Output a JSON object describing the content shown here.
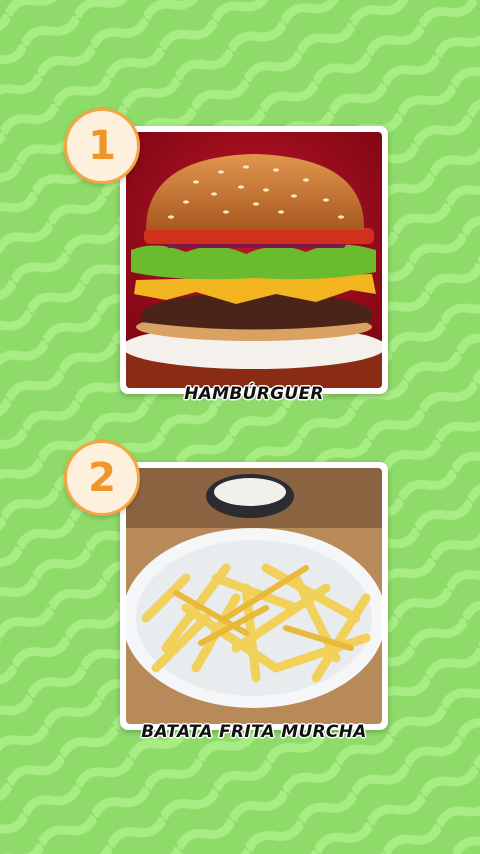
{
  "colors": {
    "background": "#8fdb6a",
    "wave": "#a6ea82",
    "badge_fill": "#fdf0dc",
    "badge_ring": "#f5a542",
    "badge_text": "#f0952a"
  },
  "items": [
    {
      "number": "1",
      "caption": "HAMBÚRGUER",
      "image": "hamburger-photo"
    },
    {
      "number": "2",
      "caption": "BATATA FRITA MURCHA",
      "image": "french-fries-photo"
    }
  ]
}
